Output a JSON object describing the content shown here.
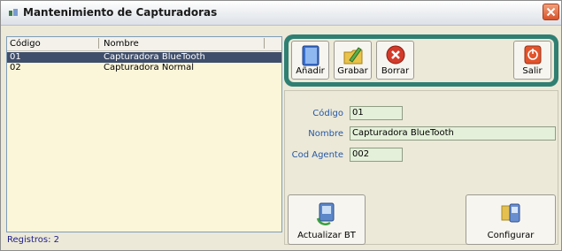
{
  "window": {
    "title": "Mantenimiento de Capturadoras"
  },
  "list": {
    "columns": [
      "Código",
      "Nombre"
    ],
    "rows": [
      {
        "codigo": "01",
        "nombre": "Capturadora BlueTooth"
      },
      {
        "codigo": "02",
        "nombre": "Capturadora Normal"
      }
    ],
    "status": "Registros: 2"
  },
  "toolbar": {
    "add_label": "Añadir",
    "save_label": "Grabar",
    "delete_label": "Borrar",
    "exit_label": "Salir"
  },
  "form": {
    "codigo_label": "Código",
    "codigo_value": "01",
    "nombre_label": "Nombre",
    "nombre_value": "Capturadora BlueTooth",
    "agente_label": "Cod Agente",
    "agente_value": "002"
  },
  "actions": {
    "update_label": "Actualizar BT",
    "config_label": "Configurar"
  },
  "colors": {
    "toolbar_frame": "#2f7f73",
    "selection": "#3f4e6b",
    "field_bg": "#e4f0d9",
    "label_blue": "#2457a6"
  }
}
